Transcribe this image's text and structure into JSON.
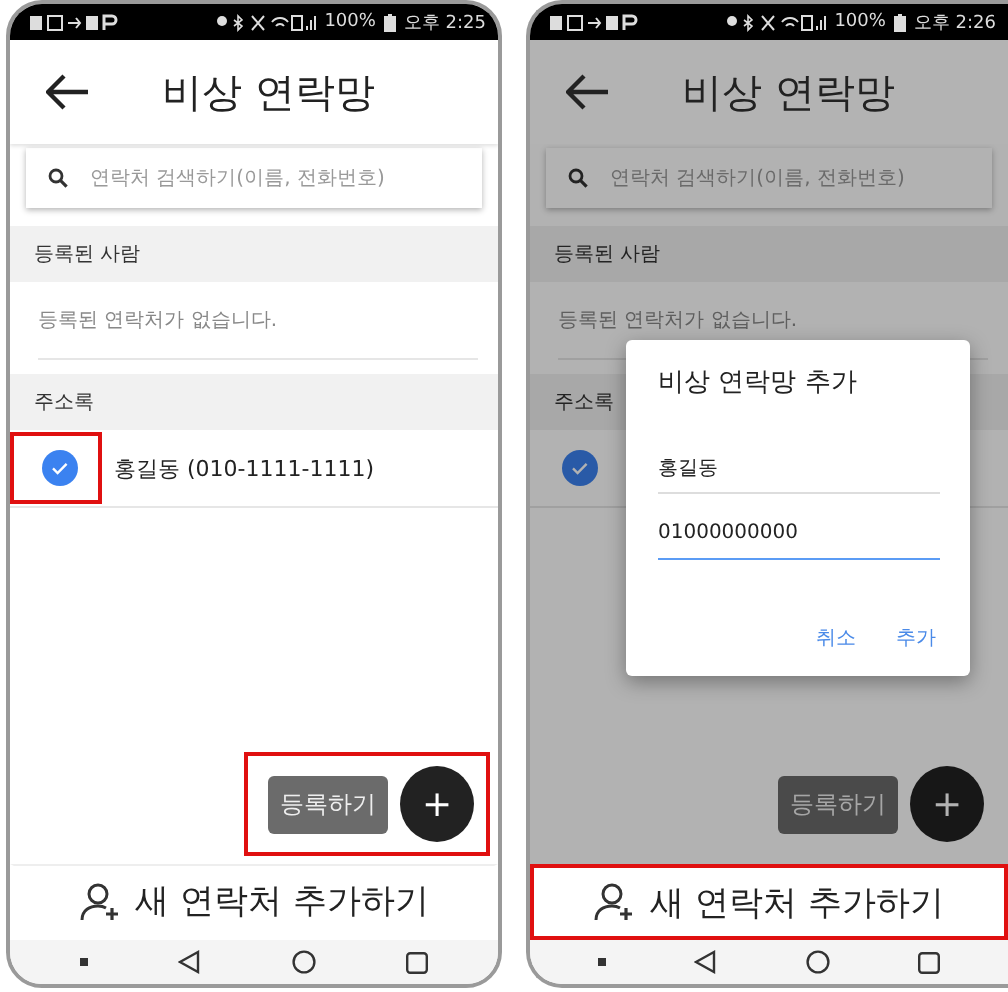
{
  "screens": [
    {
      "status_bar": {
        "battery": "100%",
        "time": "오후 2:25"
      },
      "dimmed": false,
      "title": "비상 연락망",
      "search": {
        "placeholder": "연락처 검색하기(이름, 전화번호)"
      },
      "sections": [
        {
          "header": "등록된 사람",
          "empty_message": "등록된 연락처가 없습니다."
        },
        {
          "header": "주소록",
          "contacts": [
            {
              "name": "홍길동 (010-1111-1111)",
              "checked": true,
              "highlighted": true
            }
          ]
        }
      ],
      "fab": {
        "label": "등록하기",
        "icon": "+",
        "highlighted": true
      },
      "bottom_button": {
        "label": "새 연락처 추가하기",
        "highlighted": false
      }
    },
    {
      "status_bar": {
        "battery": "100%",
        "time": "오후 2:26"
      },
      "dimmed": true,
      "title": "비상 연락망",
      "search": {
        "placeholder": "연락처 검색하기(이름, 전화번호)"
      },
      "sections": [
        {
          "header": "등록된 사람",
          "empty_message": "등록된 연락처가 없습니다."
        },
        {
          "header": "주소록",
          "contacts": [
            {
              "checked": true,
              "highlighted": false
            }
          ]
        }
      ],
      "fab": {
        "label": "등록하기",
        "icon": "+",
        "highlighted": false
      },
      "bottom_button": {
        "label": "새 연락처 추가하기",
        "highlighted": true
      },
      "dialog": {
        "title": "비상 연락망 추가",
        "fields": [
          {
            "value": "홍길동",
            "focused": false
          },
          {
            "value": "01000000000",
            "focused": true
          }
        ],
        "buttons": [
          "취소",
          "추가"
        ]
      }
    }
  ]
}
